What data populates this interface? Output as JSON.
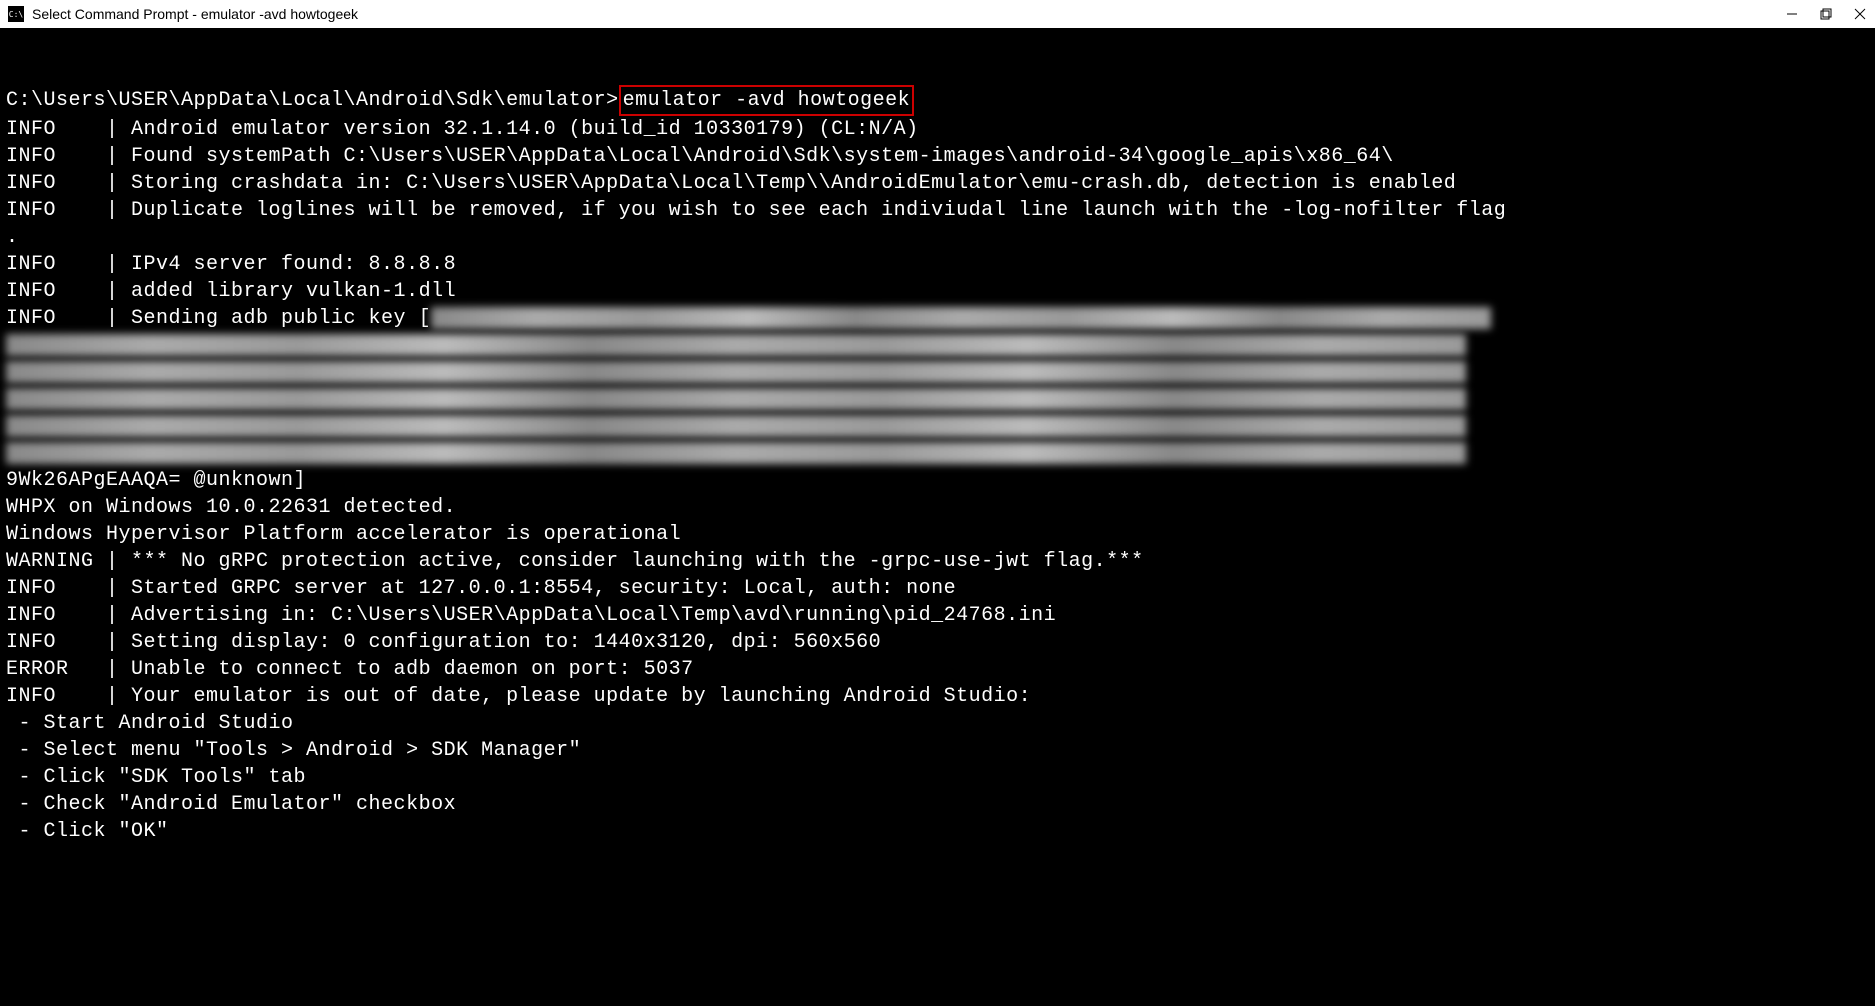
{
  "titlebar": {
    "icon_text": "C:\\",
    "title": "Select Command Prompt - emulator  -avd howtogeek"
  },
  "terminal": {
    "prompt": "C:\\Users\\USER\\AppData\\Local\\Android\\Sdk\\emulator>",
    "command": "emulator -avd howtogeek",
    "lines": [
      "INFO    | Android emulator version 32.1.14.0 (build_id 10330179) (CL:N/A)",
      "INFO    | Found systemPath C:\\Users\\USER\\AppData\\Local\\Android\\Sdk\\system-images\\android-34\\google_apis\\x86_64\\",
      "INFO    | Storing crashdata in: C:\\Users\\USER\\AppData\\Local\\Temp\\\\AndroidEmulator\\emu-crash.db, detection is enabled",
      "INFO    | Duplicate loglines will be removed, if you wish to see each indiviudal line launch with the -log-nofilter flag",
      ".",
      "INFO    | IPv4 server found: 8.8.8.8",
      "INFO    | added library vulkan-1.dll",
      "INFO    | Sending adb public key [",
      "9Wk26APgEAAQA= @unknown]",
      "WHPX on Windows 10.0.22631 detected.",
      "Windows Hypervisor Platform accelerator is operational",
      "WARNING | *** No gRPC protection active, consider launching with the -grpc-use-jwt flag.***",
      "INFO    | Started GRPC server at 127.0.0.1:8554, security: Local, auth: none",
      "INFO    | Advertising in: C:\\Users\\USER\\AppData\\Local\\Temp\\avd\\running\\pid_24768.ini",
      "INFO    | Setting display: 0 configuration to: 1440x3120, dpi: 560x560",
      "ERROR   | Unable to connect to adb daemon on port: 5037",
      "INFO    | Your emulator is out of date, please update by launching Android Studio:",
      " - Start Android Studio",
      " - Select menu \"Tools > Android > SDK Manager\"",
      " - Click \"SDK Tools\" tab",
      " - Check \"Android Emulator\" checkbox",
      " - Click \"OK\""
    ]
  }
}
